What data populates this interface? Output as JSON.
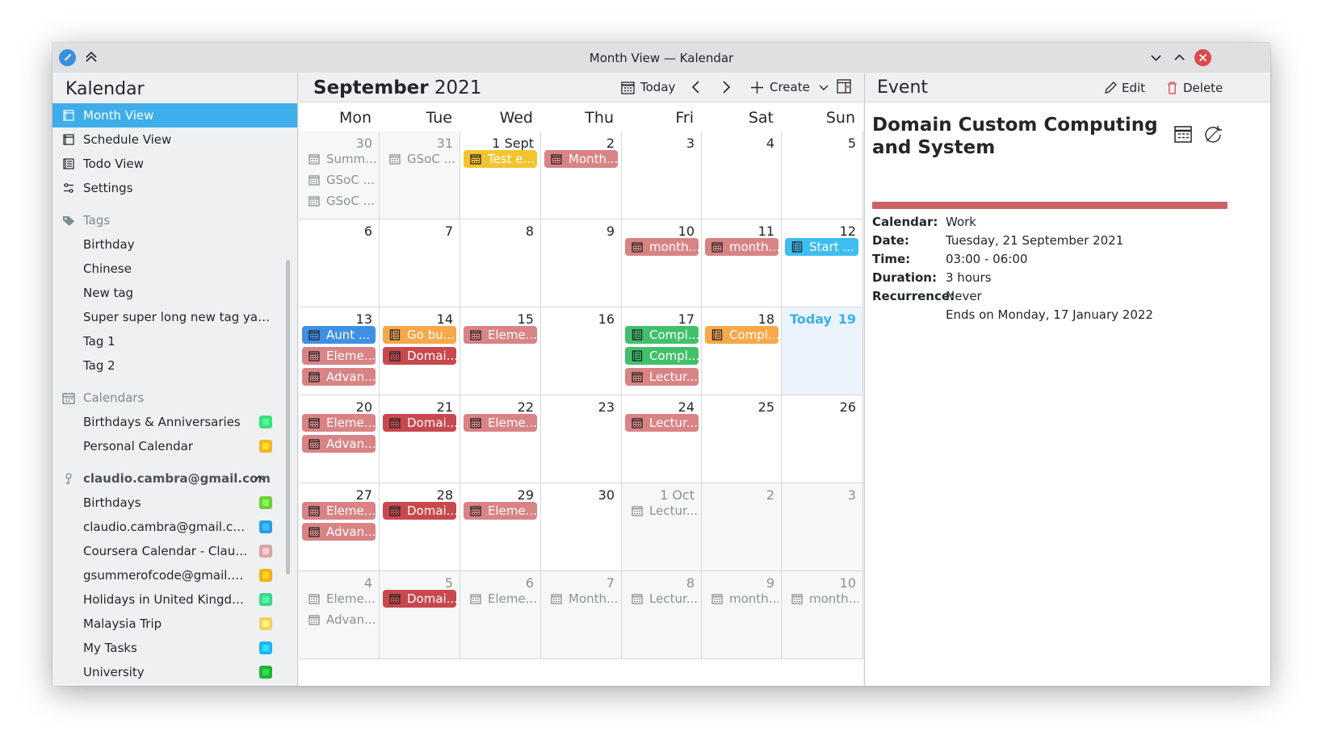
{
  "window": {
    "title": "Month View — Kalendar"
  },
  "sidebar": {
    "app_name": "Kalendar",
    "nav": [
      {
        "label": "Month View",
        "icon": "month-view-icon",
        "active": true
      },
      {
        "label": "Schedule View",
        "icon": "schedule-view-icon"
      },
      {
        "label": "Todo View",
        "icon": "todo-view-icon"
      },
      {
        "label": "Settings",
        "icon": "settings-icon"
      }
    ],
    "tags_label": "Tags",
    "tags": [
      "Birthday",
      "Chinese",
      "New tag",
      "Super super long new tag yaaa...",
      "Tag 1",
      "Tag 2"
    ],
    "calendars_label": "Calendars",
    "calendars": [
      {
        "label": "Birthdays & Anniversaries",
        "color": "#3ce07a"
      },
      {
        "label": "Personal Calendar",
        "color": "#f2b823"
      }
    ],
    "account": "claudio.cambra@gmail.com",
    "account_calendars": [
      {
        "label": "Birthdays",
        "color": "#6dcf3d"
      },
      {
        "label": "claudio.cambra@gmail.com",
        "color": "#2c9de8"
      },
      {
        "label": "Coursera Calendar - Claudi...",
        "color": "#d9a5a8"
      },
      {
        "label": "gsummerofcode@gmail.com",
        "color": "#f2b11a"
      },
      {
        "label": "Holidays in United Kingdom",
        "color": "#3fd68c"
      },
      {
        "label": "Malaysia Trip",
        "color": "#f7cf63"
      },
      {
        "label": "My Tasks",
        "color": "#1fb6f2"
      },
      {
        "label": "University",
        "color": "#23b23a"
      }
    ]
  },
  "main": {
    "month": "September",
    "year": "2021",
    "today_button": "Today",
    "create_button": "Create",
    "weekdays": [
      "Mon",
      "Tue",
      "Wed",
      "Thu",
      "Fri",
      "Sat",
      "Sun"
    ],
    "today_label": "Today",
    "weeks": [
      [
        {
          "day": "30",
          "other": true,
          "events": [
            {
              "t": "Summ...",
              "s": "plain"
            },
            {
              "t": "GSoC ...",
              "s": "plain"
            },
            {
              "t": "GSoC ...",
              "s": "plain"
            }
          ]
        },
        {
          "day": "31",
          "other": true,
          "events": [
            {
              "t": "GSoC ...",
              "s": "plain"
            }
          ]
        },
        {
          "day": "1 Sept",
          "events": [
            {
              "t": "Test e...",
              "s": "yellow"
            }
          ]
        },
        {
          "day": "2",
          "events": [
            {
              "t": "Month...",
              "s": "red"
            }
          ]
        },
        {
          "day": "3",
          "events": []
        },
        {
          "day": "4",
          "events": []
        },
        {
          "day": "5",
          "events": []
        }
      ],
      [
        {
          "day": "6",
          "events": []
        },
        {
          "day": "7",
          "events": []
        },
        {
          "day": "8",
          "events": []
        },
        {
          "day": "9",
          "events": []
        },
        {
          "day": "10",
          "events": [
            {
              "t": "month...",
              "s": "red"
            }
          ]
        },
        {
          "day": "11",
          "events": [
            {
              "t": "month...",
              "s": "red"
            }
          ]
        },
        {
          "day": "12",
          "events": [
            {
              "t": "Start ...",
              "s": "cyan",
              "todo": true
            }
          ]
        }
      ],
      [
        {
          "day": "13",
          "events": [
            {
              "t": "Aunt ...",
              "s": "blue"
            },
            {
              "t": "Eleme...",
              "s": "red"
            },
            {
              "t": "Advan...",
              "s": "red"
            }
          ]
        },
        {
          "day": "14",
          "events": [
            {
              "t": "Go bu...",
              "s": "orange",
              "todo": true
            },
            {
              "t": "Domai...",
              "s": "darkred"
            }
          ]
        },
        {
          "day": "15",
          "events": [
            {
              "t": "Eleme...",
              "s": "red"
            }
          ]
        },
        {
          "day": "16",
          "events": []
        },
        {
          "day": "17",
          "events": [
            {
              "t": "Compl...",
              "s": "green",
              "todo": true
            },
            {
              "t": "Compl...",
              "s": "green",
              "todo": true
            },
            {
              "t": "Lectur...",
              "s": "red"
            }
          ]
        },
        {
          "day": "18",
          "events": [
            {
              "t": "Compl...",
              "s": "orange",
              "todo": true
            }
          ]
        },
        {
          "day": "19",
          "today": true,
          "events": []
        }
      ],
      [
        {
          "day": "20",
          "events": [
            {
              "t": "Eleme...",
              "s": "red"
            },
            {
              "t": "Advan...",
              "s": "red"
            }
          ]
        },
        {
          "day": "21",
          "events": [
            {
              "t": "Domai...",
              "s": "darkred"
            }
          ]
        },
        {
          "day": "22",
          "events": [
            {
              "t": "Eleme...",
              "s": "red"
            }
          ]
        },
        {
          "day": "23",
          "events": []
        },
        {
          "day": "24",
          "events": [
            {
              "t": "Lectur...",
              "s": "red"
            }
          ]
        },
        {
          "day": "25",
          "events": []
        },
        {
          "day": "26",
          "events": []
        }
      ],
      [
        {
          "day": "27",
          "events": [
            {
              "t": "Eleme...",
              "s": "red"
            },
            {
              "t": "Advan...",
              "s": "red"
            }
          ]
        },
        {
          "day": "28",
          "events": [
            {
              "t": "Domai...",
              "s": "darkred"
            }
          ]
        },
        {
          "day": "29",
          "events": [
            {
              "t": "Eleme...",
              "s": "red"
            }
          ]
        },
        {
          "day": "30",
          "events": []
        },
        {
          "day": "1 Oct",
          "other": true,
          "events": [
            {
              "t": "Lectur...",
              "s": "plain"
            }
          ]
        },
        {
          "day": "2",
          "other": true,
          "events": []
        },
        {
          "day": "3",
          "other": true,
          "events": []
        }
      ],
      [
        {
          "day": "4",
          "other": true,
          "events": [
            {
              "t": "Eleme...",
              "s": "plain"
            },
            {
              "t": "Advan...",
              "s": "plain"
            }
          ]
        },
        {
          "day": "5",
          "other": true,
          "events": [
            {
              "t": "Domai...",
              "s": "darkred"
            }
          ]
        },
        {
          "day": "6",
          "other": true,
          "events": [
            {
              "t": "Eleme...",
              "s": "plain"
            }
          ]
        },
        {
          "day": "7",
          "other": true,
          "events": [
            {
              "t": "Month...",
              "s": "plain"
            }
          ]
        },
        {
          "day": "8",
          "other": true,
          "events": [
            {
              "t": "Lectur...",
              "s": "plain"
            }
          ]
        },
        {
          "day": "9",
          "other": true,
          "events": [
            {
              "t": "month...",
              "s": "plain"
            }
          ]
        },
        {
          "day": "10",
          "other": true,
          "events": [
            {
              "t": "month...",
              "s": "plain"
            }
          ]
        }
      ]
    ]
  },
  "event_panel": {
    "header": "Event",
    "edit_label": "Edit",
    "delete_label": "Delete",
    "title": "Domain Custom Computing and System",
    "color": "#cc6466",
    "props": [
      {
        "k": "Calendar:",
        "v": "Work"
      },
      {
        "k": "Date:",
        "v": "Tuesday, 21 September 2021"
      },
      {
        "k": "Time:",
        "v": "03:00 - 06:00"
      },
      {
        "k": "Duration:",
        "v": "3 hours"
      },
      {
        "k": "Recurrence:",
        "v": "Never"
      },
      {
        "k": "",
        "v": "Ends on Monday, 17 January 2022"
      }
    ]
  },
  "styles": {
    "red": {
      "bg": "#d98385",
      "fg": "#ffffff"
    },
    "darkred": {
      "bg": "#c8484d",
      "fg": "#ffffff"
    },
    "yellow": {
      "bg": "#f4c430",
      "fg": "#ffffff"
    },
    "orange": {
      "bg": "#f6a84a",
      "fg": "#ffffff"
    },
    "green": {
      "bg": "#41c06b",
      "fg": "#ffffff"
    },
    "blue": {
      "bg": "#3f90e5",
      "fg": "#ffffff"
    },
    "cyan": {
      "bg": "#3dbdf0",
      "fg": "#ffffff"
    },
    "plain": {
      "bg": "transparent",
      "fg": "#8b9195"
    }
  }
}
